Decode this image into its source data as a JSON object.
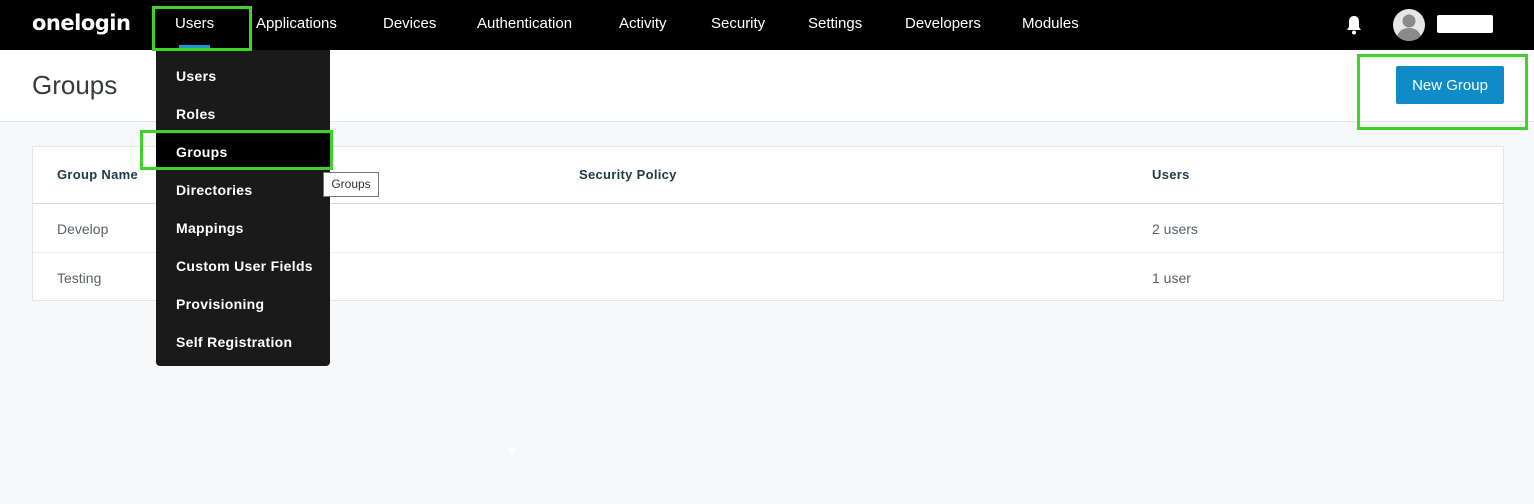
{
  "app": {
    "logo_text": "onelogin"
  },
  "nav": {
    "items": [
      {
        "label": "Users",
        "active": true
      },
      {
        "label": "Applications"
      },
      {
        "label": "Devices"
      },
      {
        "label": "Authentication"
      },
      {
        "label": "Activity"
      },
      {
        "label": "Security"
      },
      {
        "label": "Settings"
      },
      {
        "label": "Developers"
      },
      {
        "label": "Modules"
      }
    ],
    "bell_icon": "bell-icon",
    "avatar_icon": "user-avatar-icon"
  },
  "users_menu": {
    "items": [
      {
        "label": "Users"
      },
      {
        "label": "Roles"
      },
      {
        "label": "Groups",
        "hovered": true
      },
      {
        "label": "Directories"
      },
      {
        "label": "Mappings"
      },
      {
        "label": "Custom User Fields"
      },
      {
        "label": "Provisioning"
      },
      {
        "label": "Self Registration"
      }
    ],
    "tooltip": "Groups"
  },
  "page": {
    "title": "Groups",
    "new_button": "New Group"
  },
  "table": {
    "columns": [
      "Group Name",
      "Security Policy",
      "Users"
    ],
    "rows": [
      {
        "name": "Develop",
        "policy": "",
        "users": "2 users"
      },
      {
        "name": "Testing",
        "policy": "",
        "users": "1 user"
      }
    ]
  },
  "colors": {
    "topbar": "#000000",
    "accent": "#0f8bc7",
    "annotation": "#3fd32a"
  }
}
